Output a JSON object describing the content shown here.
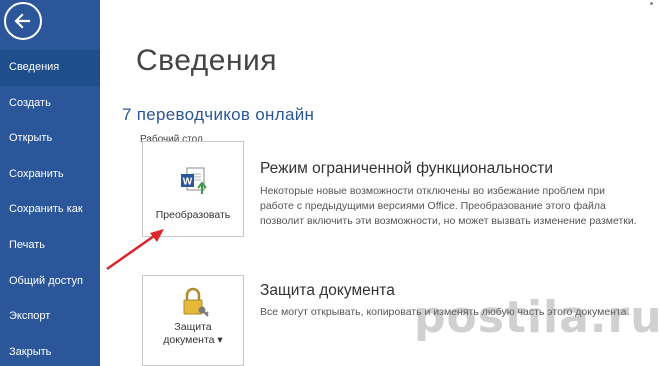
{
  "sidebar": {
    "items": [
      {
        "label": "Сведения",
        "active": true
      },
      {
        "label": "Создать"
      },
      {
        "label": "Открыть"
      },
      {
        "label": "Сохранить"
      },
      {
        "label": "Сохранить как"
      },
      {
        "label": "Печать"
      },
      {
        "label": "Общий доступ"
      },
      {
        "label": "Экспорт"
      },
      {
        "label": "Закрыть"
      }
    ]
  },
  "main": {
    "title": "Сведения",
    "document_title": "7 переводчиков онлайн",
    "document_location": "Рабочий стол",
    "compat": {
      "button_label": "Преобразовать",
      "heading": "Режим ограниченной функциональности",
      "description": "Некоторые новые возможности отключены во избежание проблем при работе с предыдущими версиями Office. Преобразование этого файла позволит включить эти возможности, но может вызвать изменение разметки."
    },
    "protect": {
      "button_label_line1": "Защита",
      "button_label_line2": "документа ▾",
      "heading": "Защита документа",
      "description": "Все могут открывать, копировать и изменять любую часть этого документа."
    }
  },
  "watermark": "postila.ru",
  "colors": {
    "sidebar": "#2b579a",
    "sidebar_active": "#1e4e8c",
    "accent_text": "#2b579a",
    "annotation_arrow": "#d9262c"
  },
  "icons": {
    "back": "back-arrow-icon",
    "convert": "word-convert-icon",
    "protect": "lock-key-icon"
  }
}
